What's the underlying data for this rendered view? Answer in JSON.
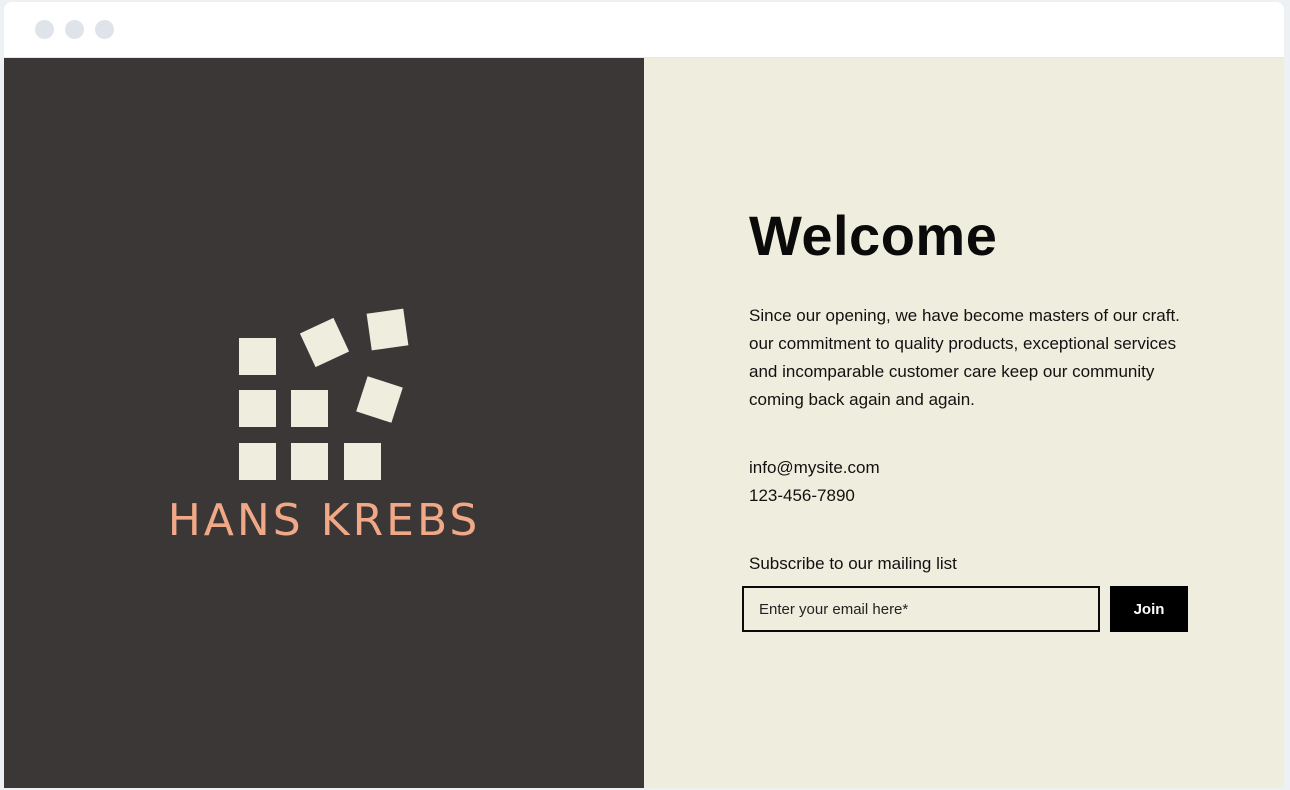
{
  "window": {
    "controls": [
      "close-dot",
      "minimize-dot",
      "maximize-dot"
    ]
  },
  "brand": {
    "name": "HANS KREBS",
    "logo_icon": "stacked-squares-logo",
    "colors": {
      "panel_bg": "#3b3736",
      "square_fill": "#efedde",
      "name_color": "#f0a887"
    }
  },
  "main": {
    "heading": "Welcome",
    "intro": "Since our opening, we have become masters of our craft. our commitment to quality products, exceptional services and incomparable customer care keep our community coming back again and again.",
    "contact": {
      "email": "info@mysite.com",
      "phone": "123-456-7890"
    },
    "subscribe": {
      "label": "Subscribe to our mailing list",
      "placeholder": "Enter your email here*",
      "value": "",
      "button_label": "Join"
    },
    "colors": {
      "panel_bg": "#efedde",
      "text": "#111111",
      "button_bg": "#000000",
      "button_text": "#ffffff"
    }
  }
}
